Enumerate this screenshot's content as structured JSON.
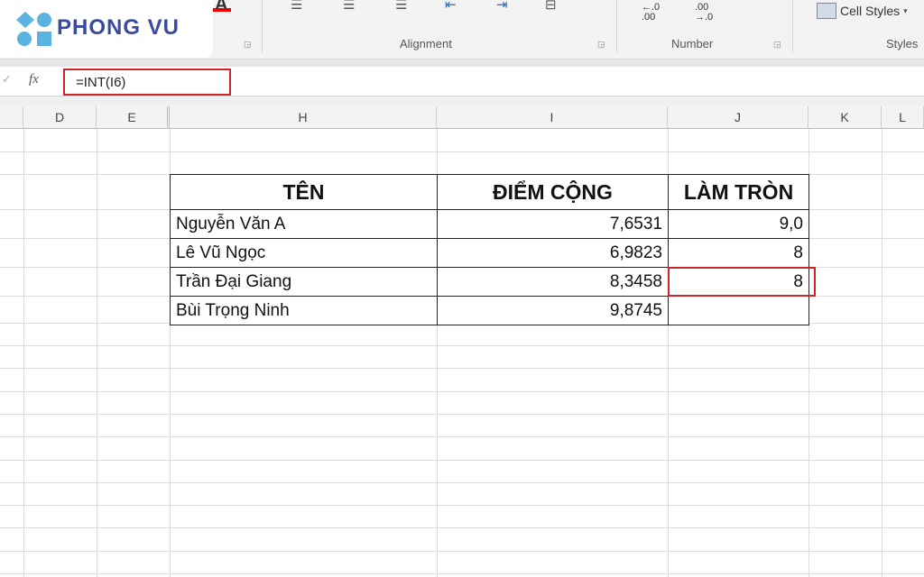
{
  "logo": {
    "text": "PHONG VU",
    "brand_color": "#3a4a9c",
    "shape_color": "#5bb3e0"
  },
  "ribbon": {
    "groups": [
      {
        "label": "Alignment"
      },
      {
        "label": "Number"
      },
      {
        "label": "Styles"
      }
    ],
    "number_buttons": {
      "increase_decimal": "←.0\n.00",
      "decrease_decimal": ".00\n→.0"
    },
    "cell_styles_label": "Cell Styles"
  },
  "formula_bar": {
    "fx_label": "fx",
    "value": "=INT(I6)",
    "highlight_color": "#d0242b"
  },
  "columns": [
    "D",
    "E",
    "H",
    "I",
    "J",
    "K",
    "L"
  ],
  "table": {
    "headers": [
      "TÊN",
      "ĐIỂM CỘNG",
      "LÀM TRÒN"
    ],
    "rows": [
      {
        "name": "Nguyễn Văn A",
        "score": "7,6531",
        "rounded": "9,0"
      },
      {
        "name": "Lê Vũ Ngọc",
        "score": "6,9823",
        "rounded": "8"
      },
      {
        "name": "Trần Đại Giang",
        "score": "8,3458",
        "rounded": "8"
      },
      {
        "name": "Bùi Trọng Ninh",
        "score": "9,8745",
        "rounded": ""
      }
    ]
  }
}
